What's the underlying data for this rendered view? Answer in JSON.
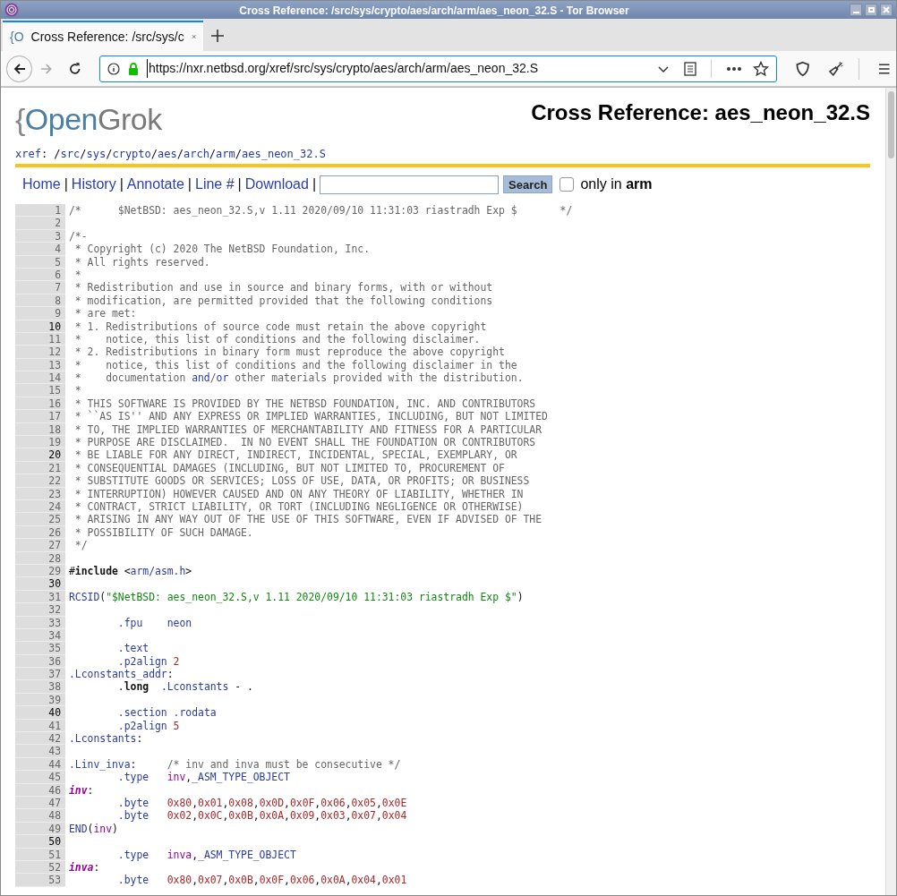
{
  "window": {
    "title": "Cross Reference: /src/sys/crypto/aes/arch/arm/aes_neon_32.S - Tor Browser"
  },
  "tabs": [
    {
      "favicon": "{O",
      "label": "Cross Reference: /src/sys/c",
      "selected": true
    }
  ],
  "address_bar": {
    "url": "https://nxr.netbsd.org/xref/src/sys/crypto/aes/arch/arm/aes_neon_32.S"
  },
  "page": {
    "logo": [
      "{",
      "Open",
      "Grok"
    ],
    "title": "Cross Reference: aes_neon_32.S",
    "breadcrumb": [
      {
        "kind": "link",
        "text": "xref"
      },
      {
        "kind": "sep",
        "text": ": /"
      },
      {
        "kind": "link",
        "text": "src"
      },
      {
        "kind": "sep",
        "text": "/"
      },
      {
        "kind": "link",
        "text": "sys"
      },
      {
        "kind": "sep",
        "text": "/"
      },
      {
        "kind": "link",
        "text": "crypto"
      },
      {
        "kind": "sep",
        "text": "/"
      },
      {
        "kind": "link",
        "text": "aes"
      },
      {
        "kind": "sep",
        "text": "/"
      },
      {
        "kind": "link",
        "text": "arch"
      },
      {
        "kind": "sep",
        "text": "/"
      },
      {
        "kind": "link",
        "text": "arm"
      },
      {
        "kind": "sep",
        "text": "/"
      },
      {
        "kind": "link",
        "text": "aes_neon_32.S"
      }
    ],
    "nav": [
      {
        "kind": "link",
        "text": "Home"
      },
      {
        "kind": "sep",
        "text": "|"
      },
      {
        "kind": "link",
        "text": "History"
      },
      {
        "kind": "sep",
        "text": "|"
      },
      {
        "kind": "link",
        "text": "Annotate"
      },
      {
        "kind": "sep",
        "text": "|"
      },
      {
        "kind": "link",
        "text": "Line #"
      },
      {
        "kind": "sep",
        "text": "|"
      },
      {
        "kind": "link",
        "text": "Download"
      },
      {
        "kind": "sep",
        "text": "|"
      }
    ],
    "search_button": "Search",
    "only_in": {
      "checked": false,
      "label": "only in **arm**"
    },
    "lines": [
      {
        "n": "1",
        "em": false,
        "s": [
          {
            "kind": "comment",
            "text": "/*      $NetBSD: aes_neon_32.S,v 1.11 2020/09/10 11:31:03 riastradh Exp $       */"
          }
        ]
      },
      {
        "n": "2",
        "em": false
      },
      {
        "n": "3",
        "em": false,
        "s": [
          {
            "kind": "comment",
            "text": "/*-"
          }
        ]
      },
      {
        "n": "4",
        "em": false,
        "s": [
          {
            "kind": "comment",
            "text": " * Copyright (c) 2020 The NetBSD Foundation, Inc."
          }
        ]
      },
      {
        "n": "5",
        "em": false,
        "s": [
          {
            "kind": "comment",
            "text": " * All rights reserved."
          }
        ]
      },
      {
        "n": "6",
        "em": false,
        "s": [
          {
            "kind": "comment",
            "text": " *"
          }
        ]
      },
      {
        "n": "7",
        "em": false,
        "s": [
          {
            "kind": "comment",
            "text": " * Redistribution and use in source and binary forms, with or without"
          }
        ]
      },
      {
        "n": "8",
        "em": false,
        "s": [
          {
            "kind": "comment",
            "text": " * modification, are permitted provided that the following conditions"
          }
        ]
      },
      {
        "n": "9",
        "em": false,
        "s": [
          {
            "kind": "comment",
            "text": " * are met:"
          }
        ]
      },
      {
        "n": "10",
        "em": true,
        "s": [
          {
            "kind": "comment",
            "text": " * 1. Redistributions of source code must retain the above copyright"
          }
        ]
      },
      {
        "n": "11",
        "em": false,
        "s": [
          {
            "kind": "comment",
            "text": " *    notice, this list of conditions and the following disclaimer."
          }
        ]
      },
      {
        "n": "12",
        "em": false,
        "s": [
          {
            "kind": "comment",
            "text": " * 2. Redistributions in binary form must reproduce the above copyright"
          }
        ]
      },
      {
        "n": "13",
        "em": false,
        "s": [
          {
            "kind": "comment",
            "text": " *    notice, this list of conditions and the following disclaimer in the"
          }
        ]
      },
      {
        "n": "14",
        "em": false,
        "s": [
          {
            "kind": "comment",
            "text": " *    documentation "
          },
          {
            "kind": "link",
            "text": "and"
          },
          {
            "kind": "comment",
            "text": "/"
          },
          {
            "kind": "link",
            "text": "or"
          },
          {
            "kind": "comment",
            "text": " other materials provided with the distribution."
          }
        ]
      },
      {
        "n": "15",
        "em": false,
        "s": [
          {
            "kind": "comment",
            "text": " *"
          }
        ]
      },
      {
        "n": "16",
        "em": false,
        "s": [
          {
            "kind": "comment",
            "text": " * THIS SOFTWARE IS PROVIDED BY THE NETBSD FOUNDATION, INC. AND CONTRIBUTORS"
          }
        ]
      },
      {
        "n": "17",
        "em": false,
        "s": [
          {
            "kind": "comment",
            "text": " * ``AS IS'' AND ANY EXPRESS OR IMPLIED WARRANTIES, INCLUDING, BUT NOT LIMITED"
          }
        ]
      },
      {
        "n": "18",
        "em": false,
        "s": [
          {
            "kind": "comment",
            "text": " * TO, THE IMPLIED WARRANTIES OF MERCHANTABILITY AND FITNESS FOR A PARTICULAR"
          }
        ]
      },
      {
        "n": "19",
        "em": false,
        "s": [
          {
            "kind": "comment",
            "text": " * PURPOSE ARE DISCLAIMED.  IN NO EVENT SHALL THE FOUNDATION OR CONTRIBUTORS"
          }
        ]
      },
      {
        "n": "20",
        "em": true,
        "s": [
          {
            "kind": "comment",
            "text": " * BE LIABLE FOR ANY DIRECT, INDIRECT, INCIDENTAL, SPECIAL, EXEMPLARY, OR"
          }
        ]
      },
      {
        "n": "21",
        "em": false,
        "s": [
          {
            "kind": "comment",
            "text": " * CONSEQUENTIAL DAMAGES (INCLUDING, BUT NOT LIMITED TO, PROCUREMENT OF"
          }
        ]
      },
      {
        "n": "22",
        "em": false,
        "s": [
          {
            "kind": "comment",
            "text": " * SUBSTITUTE GOODS OR SERVICES; LOSS OF USE, DATA, OR PROFITS; OR BUSINESS"
          }
        ]
      },
      {
        "n": "23",
        "em": false,
        "s": [
          {
            "kind": "comment",
            "text": " * INTERRUPTION) HOWEVER CAUSED AND ON ANY THEORY OF LIABILITY, WHETHER IN"
          }
        ]
      },
      {
        "n": "24",
        "em": false,
        "s": [
          {
            "kind": "comment",
            "text": " * CONTRACT, STRICT LIABILITY, OR TORT (INCLUDING NEGLIGENCE OR OTHERWISE)"
          }
        ]
      },
      {
        "n": "25",
        "em": false,
        "s": [
          {
            "kind": "comment",
            "text": " * ARISING IN ANY WAY OUT OF THE USE OF THIS SOFTWARE, EVEN IF ADVISED OF THE"
          }
        ]
      },
      {
        "n": "26",
        "em": false,
        "s": [
          {
            "kind": "comment",
            "text": " * POSSIBILITY OF SUCH DAMAGE."
          }
        ]
      },
      {
        "n": "27",
        "em": false,
        "s": [
          {
            "kind": "comment",
            "text": " */"
          }
        ]
      },
      {
        "n": "28",
        "em": false
      },
      {
        "n": "29",
        "em": false,
        "s": [
          {
            "kind": "plain",
            "text": "#"
          },
          {
            "kind": "keyword",
            "text": "include"
          },
          {
            "kind": "plain",
            "text": " <"
          },
          {
            "kind": "link",
            "text": "arm/asm.h"
          },
          {
            "kind": "plain",
            "text": ">"
          }
        ]
      },
      {
        "n": "30",
        "em": true
      },
      {
        "n": "31",
        "em": false,
        "s": [
          {
            "kind": "link",
            "text": "RCSID"
          },
          {
            "kind": "plain",
            "text": "("
          },
          {
            "kind": "string",
            "text": "\"$NetBSD: aes_neon_32.S,v 1.11 2020/09/10 11:31:03 riastradh Exp $\""
          },
          {
            "kind": "plain",
            "text": ")"
          }
        ]
      },
      {
        "n": "32",
        "em": false
      },
      {
        "n": "33",
        "em": false,
        "s": [
          {
            "kind": "link",
            "text": "        .fpu    "
          },
          {
            "kind": "link",
            "text": "neon"
          }
        ]
      },
      {
        "n": "34",
        "em": false
      },
      {
        "n": "35",
        "em": false,
        "s": [
          {
            "kind": "link",
            "text": "        .text"
          }
        ]
      },
      {
        "n": "36",
        "em": false,
        "s": [
          {
            "kind": "link",
            "text": "        .p2align "
          },
          {
            "kind": "number",
            "text": "2"
          }
        ]
      },
      {
        "n": "37",
        "em": false,
        "s": [
          {
            "kind": "link",
            "text": ".Lconstants_addr"
          },
          {
            "kind": "plain",
            "text": ":"
          }
        ]
      },
      {
        "n": "38",
        "em": false,
        "s": [
          {
            "kind": "plain",
            "text": "        ."
          },
          {
            "kind": "keyword",
            "text": "long  "
          },
          {
            "kind": "link",
            "text": ".Lconstants"
          },
          {
            "kind": "plain",
            "text": " - ."
          }
        ]
      },
      {
        "n": "39",
        "em": false
      },
      {
        "n": "40",
        "em": true,
        "s": [
          {
            "kind": "link",
            "text": "        .section "
          },
          {
            "kind": "link",
            "text": ".rodata"
          }
        ]
      },
      {
        "n": "41",
        "em": false,
        "s": [
          {
            "kind": "link",
            "text": "        .p2align "
          },
          {
            "kind": "number",
            "text": "5"
          }
        ]
      },
      {
        "n": "42",
        "em": false,
        "s": [
          {
            "kind": "link",
            "text": ".Lconstants"
          },
          {
            "kind": "plain",
            "text": ":"
          }
        ]
      },
      {
        "n": "43",
        "em": false
      },
      {
        "n": "44",
        "em": false,
        "s": [
          {
            "kind": "link",
            "text": ".Linv_inva"
          },
          {
            "kind": "plain",
            "text": ":     "
          },
          {
            "kind": "comment",
            "text": "/* inv and inva must be consecutive */"
          }
        ]
      },
      {
        "n": "45",
        "em": false,
        "s": [
          {
            "kind": "link",
            "text": "        .type   "
          },
          {
            "kind": "ref",
            "text": "inv"
          },
          {
            "kind": "plain",
            "text": ","
          },
          {
            "kind": "link",
            "text": "_ASM_TYPE_OBJECT"
          }
        ]
      },
      {
        "n": "46",
        "em": false,
        "s": [
          {
            "kind": "definition",
            "text": "inv"
          },
          {
            "kind": "plain",
            "text": ":"
          }
        ]
      },
      {
        "n": "47",
        "em": false,
        "s": [
          {
            "kind": "link",
            "text": "        .byte   "
          },
          {
            "kind": "number",
            "text": "0x80"
          },
          {
            "kind": "plain",
            "text": ","
          },
          {
            "kind": "number",
            "text": "0x01"
          },
          {
            "kind": "plain",
            "text": ","
          },
          {
            "kind": "number",
            "text": "0x08"
          },
          {
            "kind": "plain",
            "text": ","
          },
          {
            "kind": "number",
            "text": "0x0D"
          },
          {
            "kind": "plain",
            "text": ","
          },
          {
            "kind": "number",
            "text": "0x0F"
          },
          {
            "kind": "plain",
            "text": ","
          },
          {
            "kind": "number",
            "text": "0x06"
          },
          {
            "kind": "plain",
            "text": ","
          },
          {
            "kind": "number",
            "text": "0x05"
          },
          {
            "kind": "plain",
            "text": ","
          },
          {
            "kind": "number",
            "text": "0x0E"
          }
        ]
      },
      {
        "n": "48",
        "em": false,
        "s": [
          {
            "kind": "link",
            "text": "        .byte   "
          },
          {
            "kind": "number",
            "text": "0x02"
          },
          {
            "kind": "plain",
            "text": ","
          },
          {
            "kind": "number",
            "text": "0x0C"
          },
          {
            "kind": "plain",
            "text": ","
          },
          {
            "kind": "number",
            "text": "0x0B"
          },
          {
            "kind": "plain",
            "text": ","
          },
          {
            "kind": "number",
            "text": "0x0A"
          },
          {
            "kind": "plain",
            "text": ","
          },
          {
            "kind": "number",
            "text": "0x09"
          },
          {
            "kind": "plain",
            "text": ","
          },
          {
            "kind": "number",
            "text": "0x03"
          },
          {
            "kind": "plain",
            "text": ","
          },
          {
            "kind": "number",
            "text": "0x07"
          },
          {
            "kind": "plain",
            "text": ","
          },
          {
            "kind": "number",
            "text": "0x04"
          }
        ]
      },
      {
        "n": "49",
        "em": false,
        "s": [
          {
            "kind": "link",
            "text": "END"
          },
          {
            "kind": "plain",
            "text": "("
          },
          {
            "kind": "ref",
            "text": "inv"
          },
          {
            "kind": "plain",
            "text": ")"
          }
        ]
      },
      {
        "n": "50",
        "em": true
      },
      {
        "n": "51",
        "em": false,
        "s": [
          {
            "kind": "link",
            "text": "        .type   "
          },
          {
            "kind": "ref",
            "text": "inva"
          },
          {
            "kind": "plain",
            "text": ","
          },
          {
            "kind": "link",
            "text": "_ASM_TYPE_OBJECT"
          }
        ]
      },
      {
        "n": "52",
        "em": false,
        "s": [
          {
            "kind": "definition",
            "text": "inva"
          },
          {
            "kind": "plain",
            "text": ":"
          }
        ]
      },
      {
        "n": "53",
        "em": false,
        "s": [
          {
            "kind": "link",
            "text": "        .byte   "
          },
          {
            "kind": "number",
            "text": "0x80"
          },
          {
            "kind": "plain",
            "text": ","
          },
          {
            "kind": "number",
            "text": "0x07"
          },
          {
            "kind": "plain",
            "text": ","
          },
          {
            "kind": "number",
            "text": "0x0B"
          },
          {
            "kind": "plain",
            "text": ","
          },
          {
            "kind": "number",
            "text": "0x0F"
          },
          {
            "kind": "plain",
            "text": ","
          },
          {
            "kind": "number",
            "text": "0x06"
          },
          {
            "kind": "plain",
            "text": ","
          },
          {
            "kind": "number",
            "text": "0x0A"
          },
          {
            "kind": "plain",
            "text": ","
          },
          {
            "kind": "number",
            "text": "0x04"
          },
          {
            "kind": "plain",
            "text": ","
          },
          {
            "kind": "number",
            "text": "0x01"
          }
        ]
      }
    ]
  }
}
